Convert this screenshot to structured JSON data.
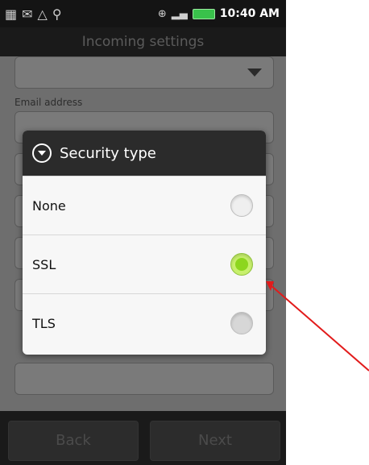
{
  "status_bar": {
    "time": "10:40 AM"
  },
  "title": "Incoming settings",
  "form": {
    "email_label": "Email address"
  },
  "footer": {
    "back_label": "Back",
    "next_label": "Next"
  },
  "dialog": {
    "title": "Security type",
    "options": [
      {
        "label": "None",
        "selected": false
      },
      {
        "label": "SSL",
        "selected": true
      },
      {
        "label": "TLS",
        "selected": false
      }
    ]
  },
  "annotation": {
    "arrow_color": "#e21b1b"
  }
}
